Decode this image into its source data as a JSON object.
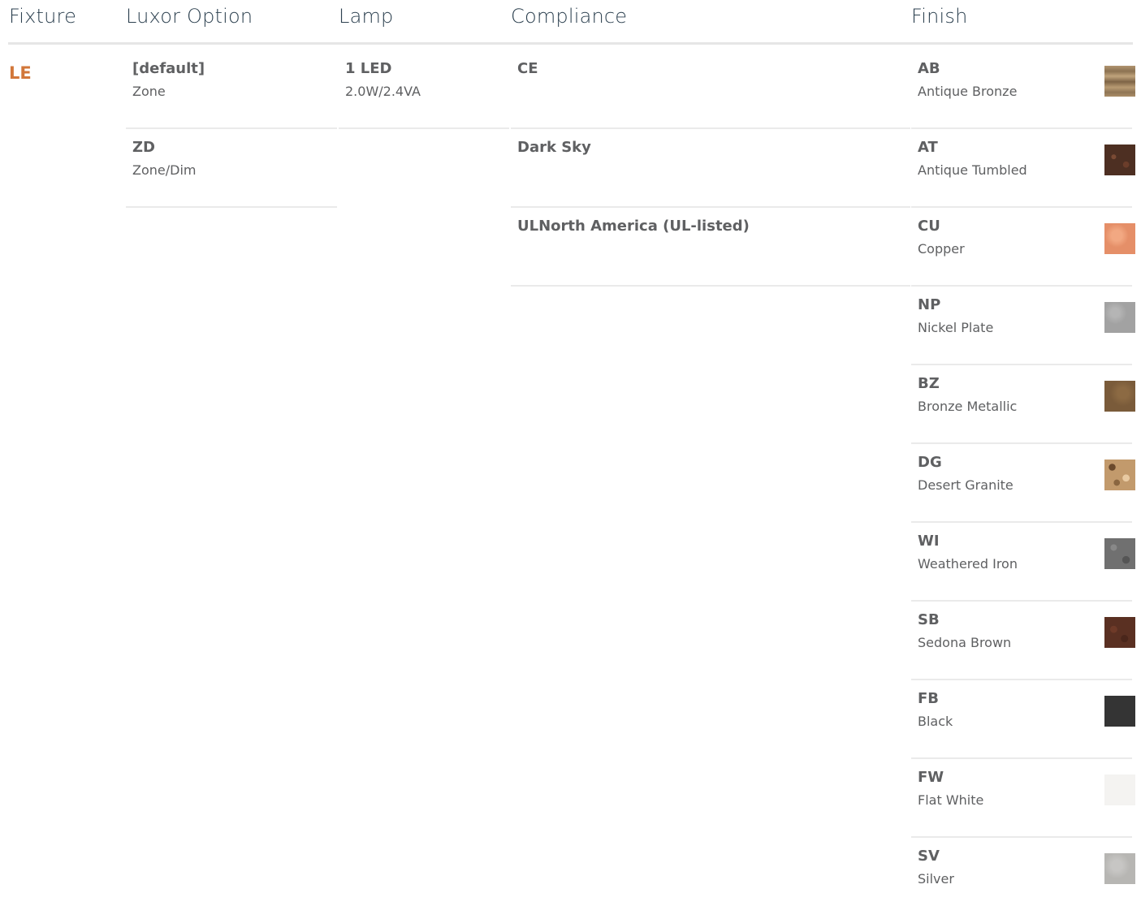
{
  "headers": {
    "fixture": "Fixture",
    "luxor": "Luxor Option",
    "lamp": "Lamp",
    "compliance": "Compliance",
    "finish": "Finish"
  },
  "fixture": {
    "code": "LE",
    "color": "#d2773a"
  },
  "luxor_options": [
    {
      "code": "[default]",
      "desc": "Zone"
    },
    {
      "code": "ZD",
      "desc": "Zone/Dim"
    }
  ],
  "lamp": [
    {
      "code": "1 LED",
      "desc": "2.0W/2.4VA"
    }
  ],
  "compliance": [
    {
      "code": "CE"
    },
    {
      "code": "Dark Sky"
    },
    {
      "code": "ULNorth America (UL-listed)"
    }
  ],
  "finishes": [
    {
      "code": "AB",
      "desc": "Antique Bronze",
      "swatch": "wood-grain-bronze"
    },
    {
      "code": "AT",
      "desc": "Antique Tumbled",
      "swatch": "dark-speckled-brown"
    },
    {
      "code": "CU",
      "desc": "Copper",
      "swatch": "copper"
    },
    {
      "code": "NP",
      "desc": "Nickel Plate",
      "swatch": "grey-mottled"
    },
    {
      "code": "BZ",
      "desc": "Bronze Metallic",
      "swatch": "bronze"
    },
    {
      "code": "DG",
      "desc": "Desert Granite",
      "swatch": "granite"
    },
    {
      "code": "WI",
      "desc": "Weathered Iron",
      "swatch": "grey-speckled"
    },
    {
      "code": "SB",
      "desc": "Sedona Brown",
      "swatch": "dark-red-brown"
    },
    {
      "code": "FB",
      "desc": "Black",
      "swatch": "#343434"
    },
    {
      "code": "FW",
      "desc": "Flat White",
      "swatch": "#f4f3f1"
    },
    {
      "code": "SV",
      "desc": "Silver",
      "swatch": "light-grey"
    }
  ]
}
